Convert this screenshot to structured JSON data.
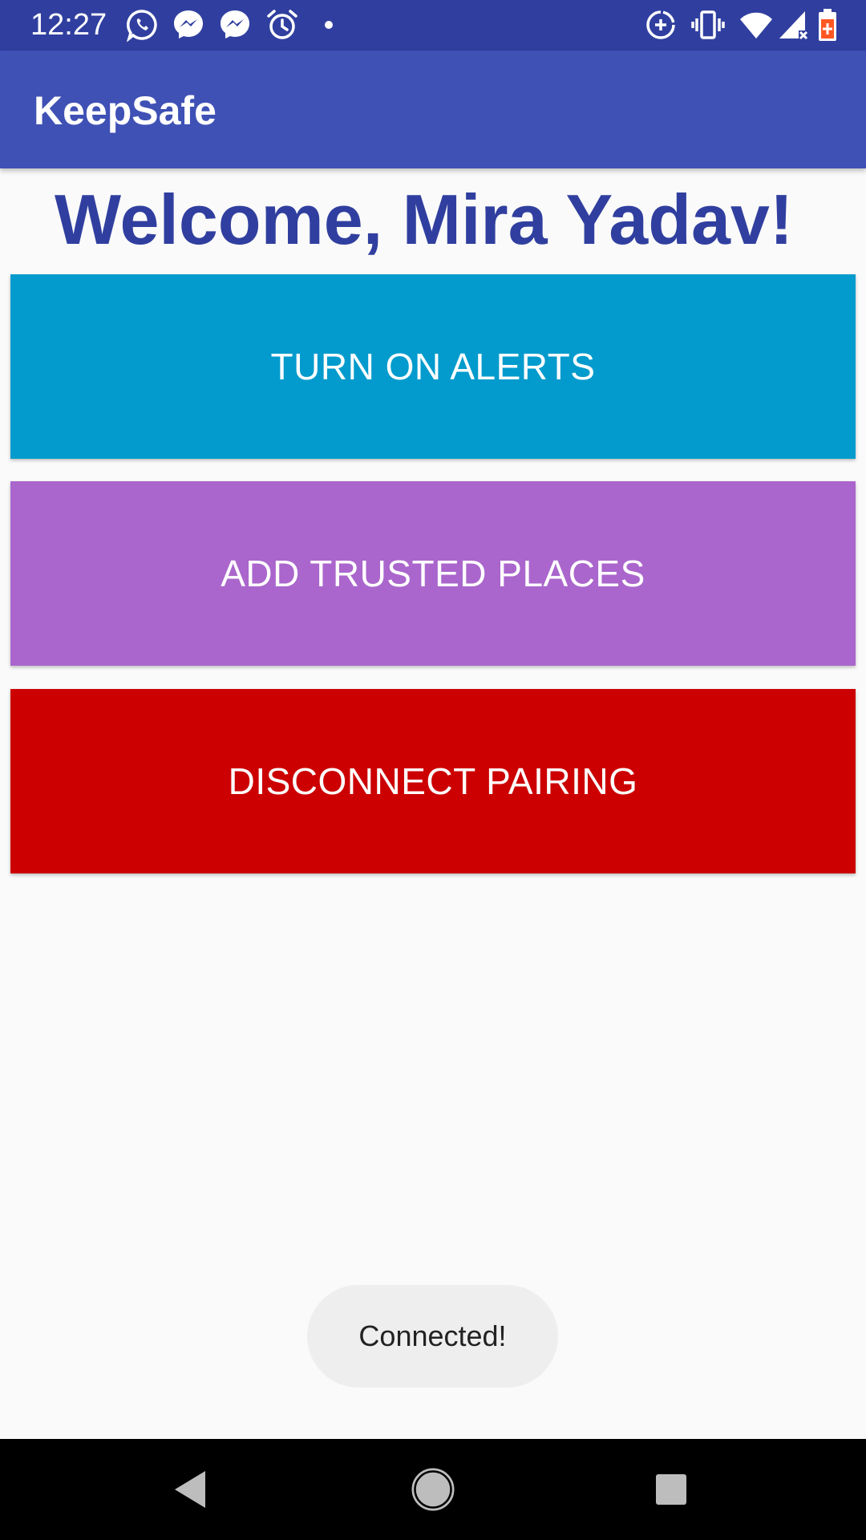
{
  "status_bar": {
    "time": "12:27",
    "left_icons": [
      "whatsapp-icon",
      "messenger-icon",
      "messenger-icon",
      "alarm-icon",
      "notification-dot-icon"
    ],
    "right_icons": [
      "data-saver-icon",
      "vibrate-icon",
      "wifi-icon",
      "signal-icon",
      "battery-icon"
    ],
    "color": "#303f9f"
  },
  "app_bar": {
    "title": "KeepSafe",
    "color": "#3f51b5"
  },
  "welcome": {
    "text": "Welcome, Mira Yadav!",
    "color": "#303f9f"
  },
  "actions": {
    "alerts_label": "TURN ON ALERTS",
    "alerts_color": "#039bcd",
    "places_label": "ADD TRUSTED PLACES",
    "places_color": "#aa66cc",
    "disconnect_label": "DISCONNECT PAIRING",
    "disconnect_color": "#cc0000"
  },
  "toast": {
    "message": "Connected!"
  },
  "nav_bar": {
    "buttons": [
      "back-icon",
      "home-icon",
      "recents-icon"
    ]
  }
}
